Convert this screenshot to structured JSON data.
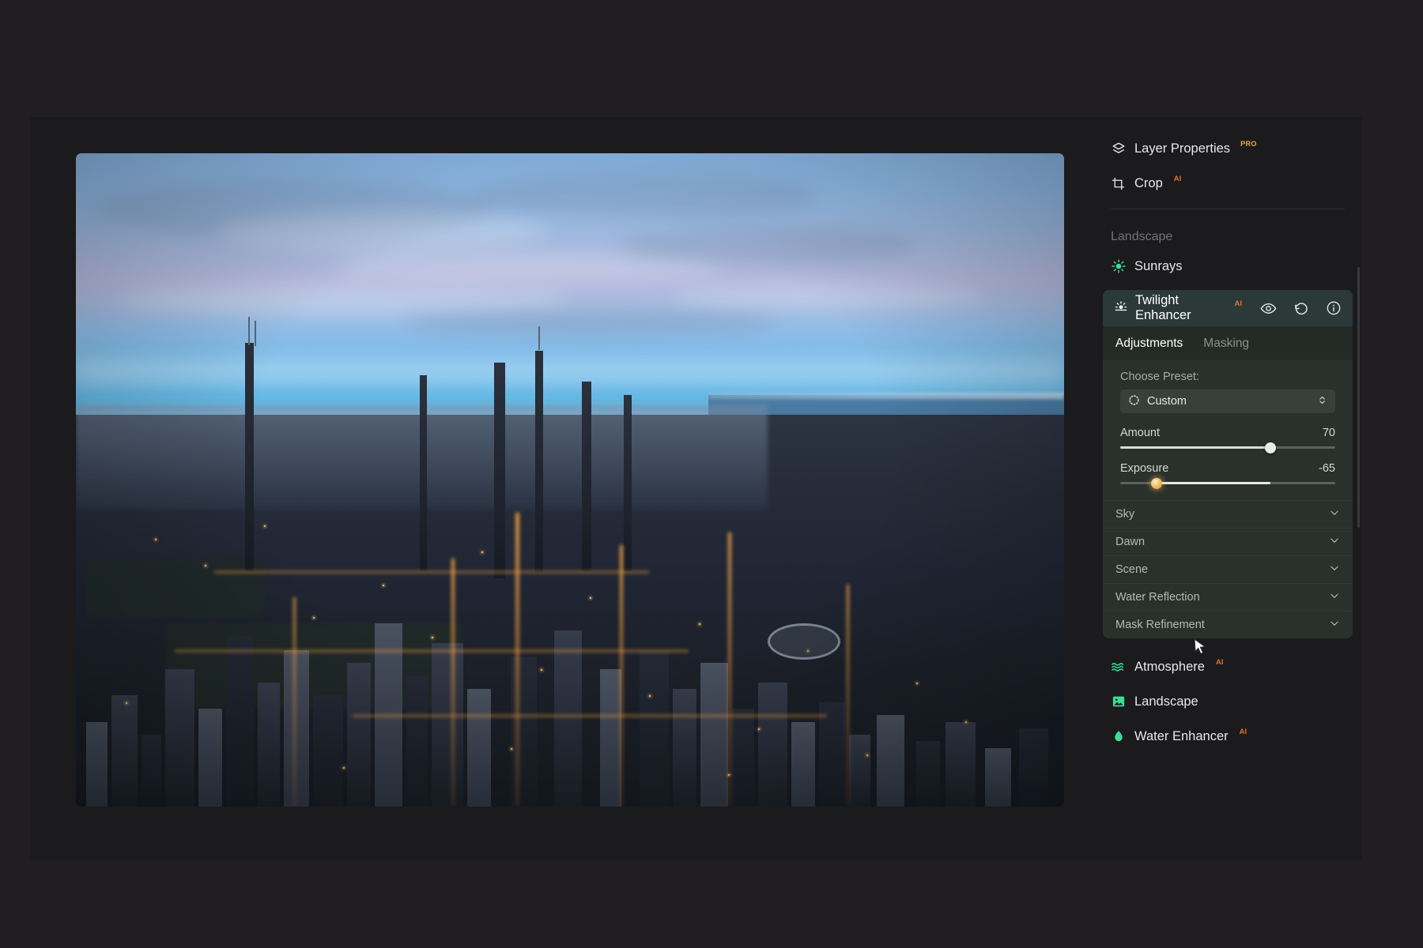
{
  "app": {
    "panel_items_top": [
      {
        "label": "Layer Properties",
        "badge": "PRO",
        "icon": "layers-icon"
      },
      {
        "label": "Crop",
        "badge": "AI",
        "icon": "crop-icon"
      }
    ],
    "group_title": "Landscape",
    "sunrays": {
      "label": "Sunrays",
      "icon": "sunrays-icon"
    },
    "twilight": {
      "title": "Twilight Enhancer",
      "badge": "AI",
      "icon": "twilight-icon",
      "actions": [
        "visibility-eye-icon",
        "reset-undo-icon",
        "info-icon"
      ],
      "tabs": [
        {
          "label": "Adjustments",
          "active": true
        },
        {
          "label": "Masking",
          "active": false
        }
      ],
      "preset_label": "Choose Preset:",
      "preset_value": "Custom",
      "sliders": [
        {
          "name": "Amount",
          "value": "70",
          "percent": 70,
          "knob_color": "#e9ebe8"
        },
        {
          "name": "Exposure",
          "value": "-65",
          "percent": 17,
          "knob_color": "#f2c066"
        }
      ],
      "sections": [
        {
          "label": "Sky"
        },
        {
          "label": "Dawn"
        },
        {
          "label": "Scene"
        },
        {
          "label": "Water Reflection"
        },
        {
          "label": "Mask Refinement"
        }
      ]
    },
    "panel_items_bottom": [
      {
        "label": "Atmosphere",
        "badge": "AI",
        "icon": "atmosphere-waves-icon"
      },
      {
        "label": "Landscape",
        "badge": "",
        "icon": "landscape-image-icon"
      },
      {
        "label": "Water Enhancer",
        "badge": "AI",
        "icon": "water-droplet-icon"
      }
    ]
  },
  "colors": {
    "accent_green": "#3ddc97",
    "badge_pro": "#e3b23c",
    "badge_ai": "#e2722c",
    "card_header": "#2b3a38",
    "panel_bg": "#1b1a1d"
  }
}
